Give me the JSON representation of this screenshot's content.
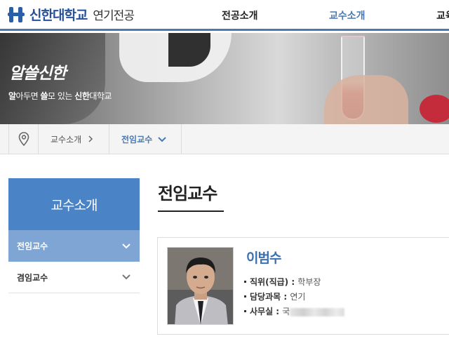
{
  "header": {
    "logo_name": "신한대학교",
    "dept_name": "연기전공",
    "nav": [
      "전공소개",
      "교수소개",
      "교육"
    ],
    "active_nav": "교수소개",
    "colors": {
      "brand": "#27509a",
      "accent": "#4a79b4"
    }
  },
  "hero": {
    "title": "알쓸신한",
    "subtitle_parts": [
      {
        "text": "알",
        "bold": true
      },
      {
        "text": "아두면 ",
        "bold": false
      },
      {
        "text": "쓸",
        "bold": true
      },
      {
        "text": "모 있는 ",
        "bold": false
      },
      {
        "text": "신한",
        "bold": true
      },
      {
        "text": "대학교",
        "bold": false
      }
    ]
  },
  "breadcrumb": {
    "home_icon": "location-pin-icon",
    "items": [
      "교수소개",
      "전임교수"
    ]
  },
  "sidebar": {
    "title": "교수소개",
    "items": [
      {
        "label": "전임교수",
        "active": true
      },
      {
        "label": "겸임교수",
        "active": false
      }
    ]
  },
  "main": {
    "title": "전임교수",
    "professor": {
      "name": "이범수",
      "fields": [
        {
          "label": "직위(직급)",
          "value": "학부장"
        },
        {
          "label": "담당과목",
          "value": "연기"
        },
        {
          "label": "사무실",
          "value": "국"
        }
      ]
    }
  }
}
